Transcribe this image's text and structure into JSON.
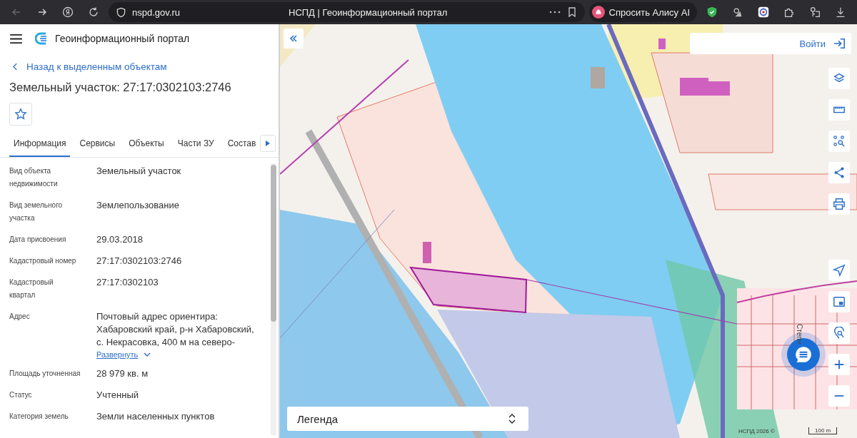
{
  "browser": {
    "url": "nspd.gov.ru",
    "tab_title": "НСПД | Геоинформационный портал",
    "assistant_button": "Спросить Алису AI"
  },
  "header": {
    "title": "Геоинформационный портал"
  },
  "back_link": "Назад к выделенным объектам",
  "object_title": "Земельный участок: 27:17:0302103:2746",
  "tabs": [
    {
      "label": "Информация",
      "selected": true
    },
    {
      "label": "Сервисы",
      "selected": false
    },
    {
      "label": "Объекты",
      "selected": false
    },
    {
      "label": "Части ЗУ",
      "selected": false
    },
    {
      "label": "Состав",
      "selected": false
    }
  ],
  "properties": [
    {
      "label": "Вид объекта недвижимости",
      "value": "Земельный участок"
    },
    {
      "label": "Вид земельного участка",
      "value": "Землепользование"
    },
    {
      "label": "Дата присвоения",
      "value": "29.03.2018"
    },
    {
      "label": "Кадастровый номер",
      "value": "27:17:0302103:2746"
    },
    {
      "label": "Кадастровый квартал",
      "value": "27:17:0302103"
    },
    {
      "label": "Адрес",
      "value": "Почтовый адрес ориентира: Хабаровский край, р-н Хабаровский, с. Некрасовка, 400 м на северо-",
      "expand_link": "Развернуть"
    },
    {
      "label": "Площадь уточненная",
      "value": "28 979 кв. м"
    },
    {
      "label": "Статус",
      "value": "Учтенный"
    },
    {
      "label": "Категория земель",
      "value": "Земли населенных пунктов"
    }
  ],
  "map": {
    "login_button": "Войти",
    "legend": "Легенда",
    "attribution": "НСПД 2026 ©",
    "scale": "100 m",
    "street_label": "Степн"
  }
}
